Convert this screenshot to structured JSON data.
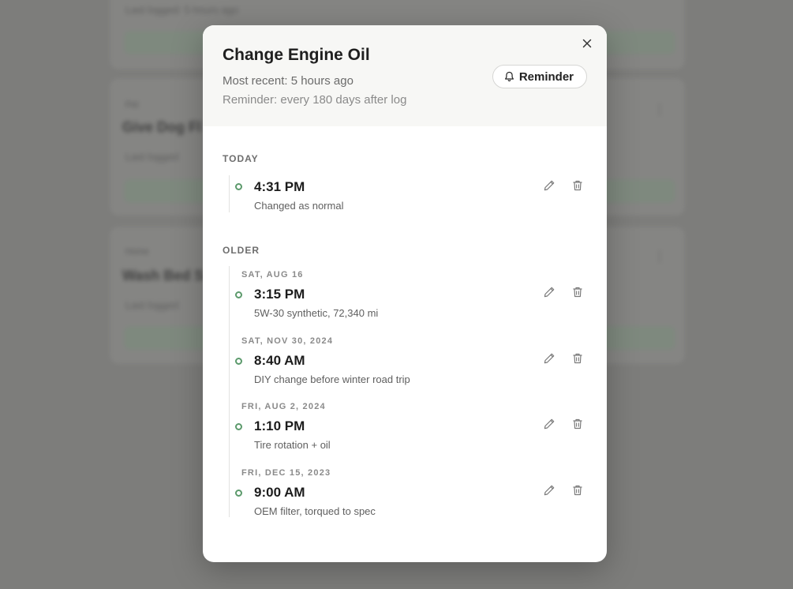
{
  "background": {
    "cards": [
      {
        "chip": "",
        "title": "",
        "sub": "Last logged: 5 hours ago"
      },
      {
        "chip": "Pet",
        "title": "Give Dog Fl",
        "sub": "Last logged"
      },
      {
        "chip": "Home",
        "title": "Wash Bed S",
        "sub": "Last logged"
      }
    ]
  },
  "modal": {
    "title": "Change Engine Oil",
    "most_recent": "Most recent: 5 hours ago",
    "reminder_text": "Reminder: every 180 days after log",
    "reminder_button": "Reminder",
    "close_icon": "close-icon",
    "accent_color": "#5c9a6c"
  },
  "sections": {
    "today_label": "TODAY",
    "older_label": "OLDER"
  },
  "today": [
    {
      "time": "4:31 PM",
      "note": "Changed as normal"
    }
  ],
  "older": [
    {
      "date": "SAT, AUG 16",
      "time": "3:15 PM",
      "note": "5W-30 synthetic, 72,340 mi"
    },
    {
      "date": "SAT, NOV 30, 2024",
      "time": "8:40 AM",
      "note": "DIY change before winter road trip"
    },
    {
      "date": "FRI, AUG 2, 2024",
      "time": "1:10 PM",
      "note": "Tire rotation + oil"
    },
    {
      "date": "FRI, DEC 15, 2023",
      "time": "9:00 AM",
      "note": "OEM filter, torqued to spec"
    }
  ]
}
